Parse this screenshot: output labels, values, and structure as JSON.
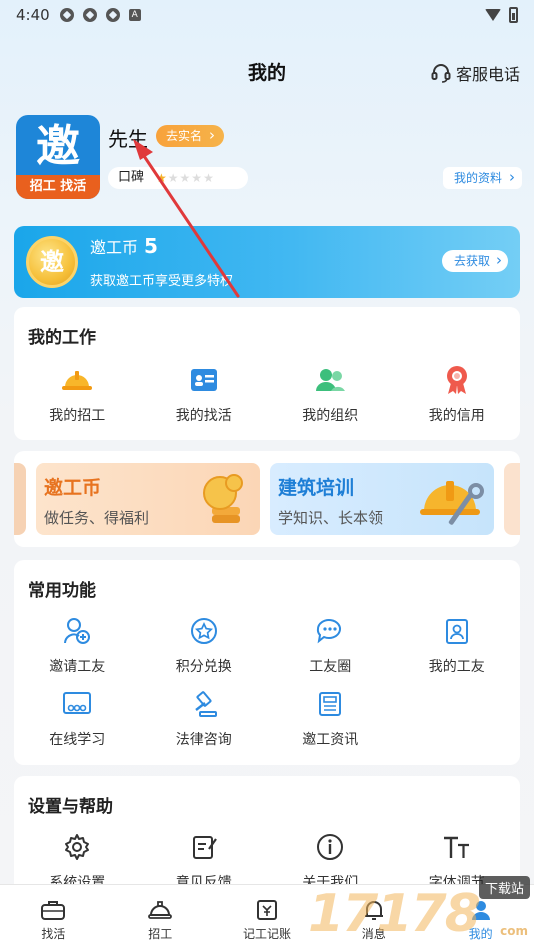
{
  "status": {
    "time": "4:40",
    "a_label": "A"
  },
  "header": {
    "title": "我的",
    "service": "客服电话"
  },
  "profile": {
    "logo_char": "邀",
    "logo_band": "招工 找活",
    "name": "先生",
    "verify": "去实名",
    "reputation_label": "口碑",
    "stars": {
      "filled": 1,
      "total": 5
    },
    "my_info": "我的资料"
  },
  "coin_banner": {
    "title": "邀工币",
    "count": "5",
    "subtitle": "获取邀工币享受更多特权",
    "get": "去获取",
    "coin_char": "邀"
  },
  "my_work": {
    "title": "我的工作",
    "items": [
      {
        "label": "我的招工",
        "icon": "hardhat-icon"
      },
      {
        "label": "我的找活",
        "icon": "resume-icon"
      },
      {
        "label": "我的组织",
        "icon": "group-icon"
      },
      {
        "label": "我的信用",
        "icon": "medal-icon"
      }
    ]
  },
  "promos": [
    {
      "title": "邀工币",
      "subtitle": "做任务、得福利"
    },
    {
      "title": "建筑培训",
      "subtitle": "学知识、长本领"
    }
  ],
  "common": {
    "title": "常用功能",
    "items": [
      {
        "label": "邀请工友",
        "icon": "invite-icon"
      },
      {
        "label": "积分兑换",
        "icon": "star-badge-icon"
      },
      {
        "label": "工友圈",
        "icon": "chat-icon"
      },
      {
        "label": "我的工友",
        "icon": "contacts-icon"
      },
      {
        "label": "在线学习",
        "icon": "video-icon"
      },
      {
        "label": "法律咨询",
        "icon": "gavel-icon"
      },
      {
        "label": "邀工资讯",
        "icon": "news-icon"
      }
    ]
  },
  "settings": {
    "title": "设置与帮助",
    "items": [
      {
        "label": "系统设置",
        "icon": "gear-icon"
      },
      {
        "label": "意见反馈",
        "icon": "feedback-icon"
      },
      {
        "label": "关于我们",
        "icon": "info-icon"
      },
      {
        "label": "字体调节",
        "icon": "font-size-icon"
      }
    ]
  },
  "nav": [
    {
      "label": "找活",
      "icon": "briefcase-icon"
    },
    {
      "label": "招工",
      "icon": "helmet-icon"
    },
    {
      "label": "记工记账",
      "icon": "ledger-icon"
    },
    {
      "label": "消息",
      "icon": "bell-icon"
    },
    {
      "label": "我的",
      "icon": "user-icon",
      "active": true
    }
  ],
  "watermark": {
    "digits": "17178",
    "tag": "下载站",
    "suffix": "com"
  },
  "colors": {
    "accent": "#2e8be0",
    "orange": "#f8a23b",
    "card": "#ffffff"
  }
}
